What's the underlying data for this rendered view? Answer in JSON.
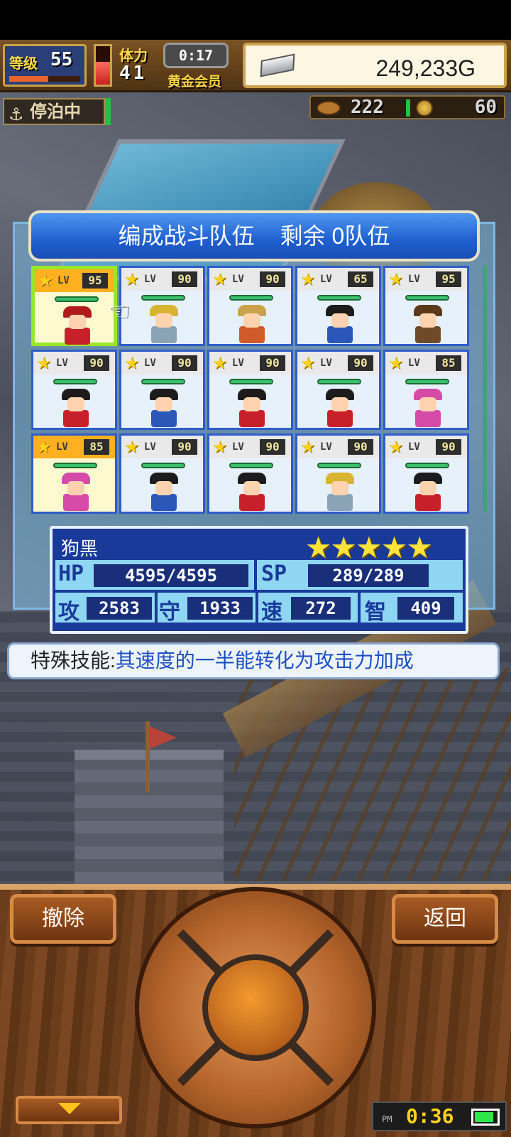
{
  "hud": {
    "level_label": "等级",
    "level_value": "55",
    "level_progress": 0.55,
    "stamina_label": "体力",
    "stamina_value": "41",
    "stamina_fraction": 0.6,
    "timer": "0:17",
    "member_label": "黄金会员",
    "gold_value": "249,233G",
    "anchor_status": "停泊中",
    "food_value": "222",
    "coin_value": "60"
  },
  "dialog": {
    "title_main": "编成战斗队伍",
    "title_remaining": "剩余 0队伍"
  },
  "cards": [
    {
      "lv_tag": "LV",
      "level": "95",
      "selected": true,
      "hat": "#b01c1c",
      "body": "#c8202a"
    },
    {
      "lv_tag": "LV",
      "level": "90",
      "selected": false,
      "hat": "#d9b431",
      "body": "#8aa3b5"
    },
    {
      "lv_tag": "LV",
      "level": "90",
      "selected": false,
      "hat": "#c9a24b",
      "body": "#d15a2b"
    },
    {
      "lv_tag": "LV",
      "level": "65",
      "selected": false,
      "hat": "#1c1c1c",
      "body": "#2a57b8"
    },
    {
      "lv_tag": "LV",
      "level": "95",
      "selected": false,
      "hat": "#5a3a1a",
      "body": "#6e4a2a"
    },
    {
      "lv_tag": "LV",
      "level": "90",
      "selected": false,
      "hat": "#1c1c1c",
      "body": "#c8202a"
    },
    {
      "lv_tag": "LV",
      "level": "90",
      "selected": false,
      "hat": "#1c1c1c",
      "body": "#2a57b8"
    },
    {
      "lv_tag": "LV",
      "level": "90",
      "selected": false,
      "hat": "#1c1c1c",
      "body": "#c8202a"
    },
    {
      "lv_tag": "LV",
      "level": "90",
      "selected": false,
      "hat": "#1c1c1c",
      "body": "#c8202a"
    },
    {
      "lv_tag": "LV",
      "level": "85",
      "selected": false,
      "hat": "#d64aa8",
      "body": "#d64aa8"
    },
    {
      "lv_tag": "LV",
      "level": "85",
      "selected": true,
      "hat": "#d64aa8",
      "body": "#d64aa8"
    },
    {
      "lv_tag": "LV",
      "level": "90",
      "selected": false,
      "hat": "#1c1c1c",
      "body": "#2a57b8"
    },
    {
      "lv_tag": "LV",
      "level": "90",
      "selected": false,
      "hat": "#1c1c1c",
      "body": "#c8202a"
    },
    {
      "lv_tag": "LV",
      "level": "90",
      "selected": false,
      "hat": "#d9b431",
      "body": "#8aa3b5"
    },
    {
      "lv_tag": "LV",
      "level": "90",
      "selected": false,
      "hat": "#1c1c1c",
      "body": "#c8202a"
    }
  ],
  "info": {
    "name": "狗黑",
    "stars": "★★★★★",
    "hp_label": "HP",
    "hp_value": "4595/4595",
    "sp_label": "SP",
    "sp_value": "289/289",
    "atk_label": "攻",
    "atk_value": "2583",
    "def_label": "守",
    "def_value": "1933",
    "spd_label": "速",
    "spd_value": "272",
    "int_label": "智",
    "int_value": "409"
  },
  "skill": {
    "label": "特殊技能:",
    "text": "其速度的一半能转化为攻击力加成"
  },
  "controls": {
    "remove_label": "撤除",
    "back_label": "返回"
  },
  "clock": {
    "ampm": "PM",
    "time": "0:36",
    "battery_level": 0.8
  },
  "colors": {
    "selected_card_border": "#9ae62a",
    "dialog_blue": "#1f5fcf",
    "skill_text": "#1f4fc0"
  }
}
